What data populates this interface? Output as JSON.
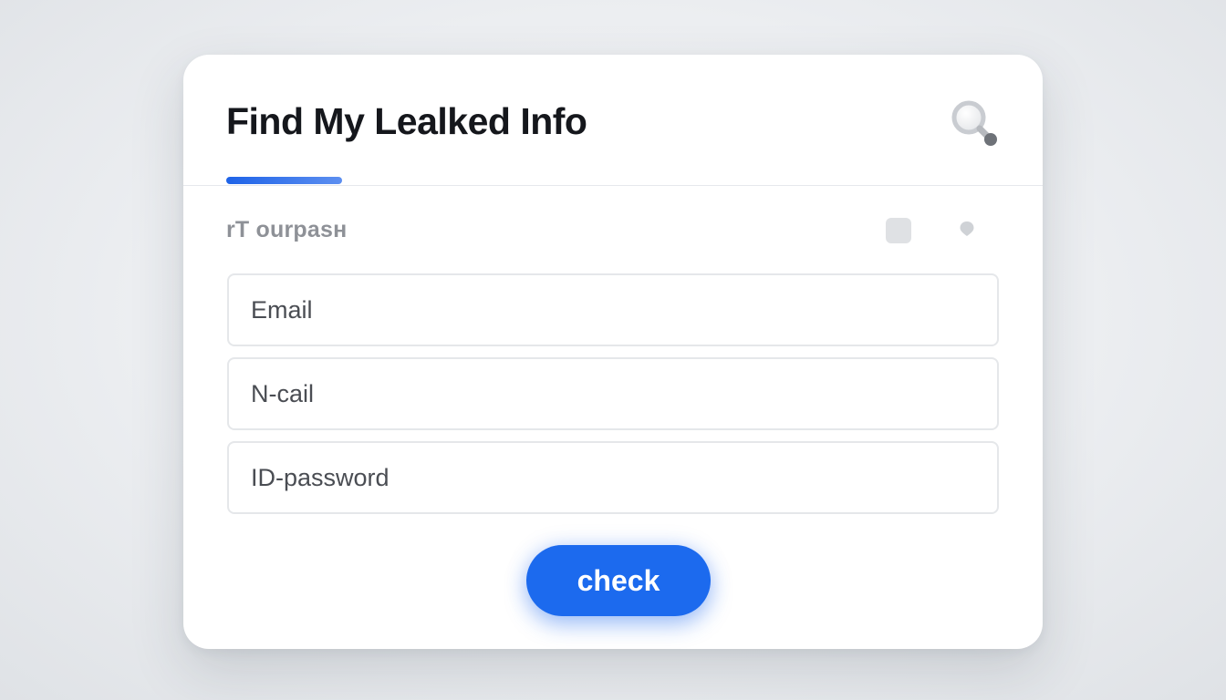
{
  "card": {
    "title": "Find My Lealked Info",
    "section_label": "rT ourpasн"
  },
  "fields": [
    {
      "placeholder": "Email"
    },
    {
      "placeholder": "N-cail"
    },
    {
      "placeholder": "ID-password"
    }
  ],
  "actions": {
    "check_label": "check"
  },
  "icons": {
    "header_action": "search-icon",
    "section_square": "square-icon",
    "section_dot": "location-pin-icon"
  },
  "colors": {
    "accent": "#1c6aee",
    "tab_indicator": "#1e63e8",
    "title_text": "#15171c",
    "muted_text": "#8e9197"
  }
}
